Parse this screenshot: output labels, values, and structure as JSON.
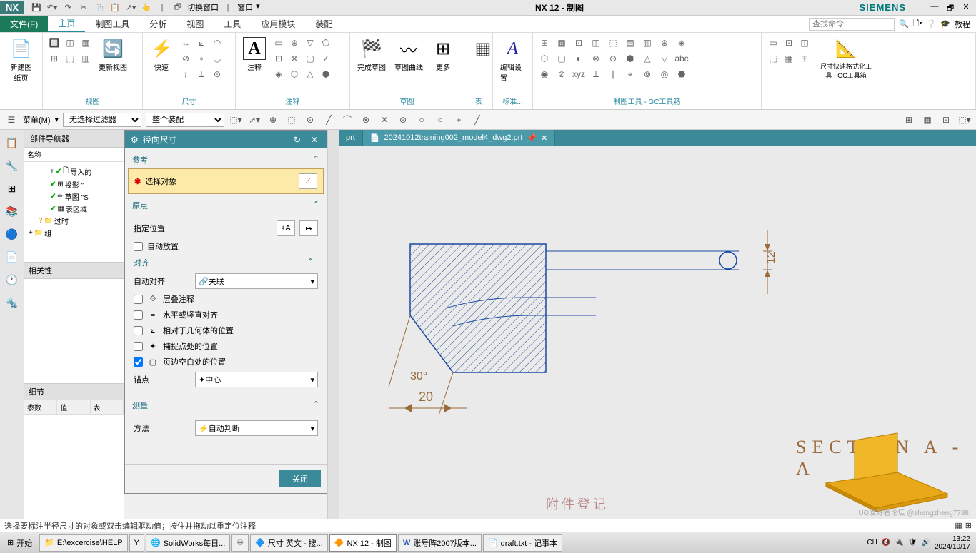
{
  "title": "NX 12 - 制图",
  "brand": "SIEMENS",
  "menubar": {
    "file": "文件(F)",
    "tabs": [
      "主页",
      "制图工具",
      "分析",
      "视图",
      "工具",
      "应用模块",
      "装配"
    ],
    "search_placeholder": "查找命令",
    "tutorial": "教程"
  },
  "qat": {
    "switch_window": "切换窗口",
    "window": "窗口"
  },
  "ribbon": {
    "new_sheet": "新建图纸页",
    "update_view": "更新视图",
    "rapid": "快速",
    "annotate": "注释",
    "finish_sketch": "完成草图",
    "sketch_curve": "草图曲线",
    "more": "更多",
    "edit_settings": "编辑设置",
    "dim_format": "尺寸快速格式化工具 - GC工具箱",
    "groups": {
      "view": "视图",
      "dimension": "尺寸",
      "annotation": "注释",
      "sketch": "草图",
      "table": "表",
      "standard": "标准...",
      "drafting_tools": "制图工具 - GC工具箱"
    }
  },
  "toolbar2": {
    "menu": "菜单(M)",
    "no_filter": "无选择过滤器",
    "whole_assembly": "整个装配"
  },
  "nav": {
    "title": "部件导航器",
    "col_name": "名称",
    "items": {
      "imported": "导入的",
      "projection": "投影 \"",
      "sketch": "草图 \"S",
      "table_area": "表区域",
      "outdated": "过时",
      "group": "组"
    },
    "relativity": "相关性",
    "detail": "细节",
    "cols": {
      "param": "参数",
      "value": "值",
      "expr": "表"
    }
  },
  "dialog": {
    "title": "径向尺寸",
    "sections": {
      "reference": "参考",
      "select_object": "选择对象",
      "origin": "原点",
      "specify_position": "指定位置",
      "auto_place": "自动放置",
      "alignment": "对齐",
      "auto_align_label": "自动对齐",
      "auto_align_value": "关联",
      "overlay_annotation": "层叠注释",
      "horiz_vert_align": "水平或竖直对齐",
      "relative_to_geometry": "相对于几何体的位置",
      "snap_point_pos": "捕捉点处的位置",
      "page_margin_pos": "页边空白处的位置",
      "anchor_label": "锚点",
      "anchor_value": "中心",
      "measure": "测量",
      "method_label": "方法",
      "method_value": "自动判断"
    },
    "close": "关闭"
  },
  "canvas": {
    "tab1": "prt",
    "tab2": "20241012training002_model4_dwg2.prt",
    "section_label": "SECTION  A - A",
    "dim_12": "12",
    "dim_20": "20",
    "dim_30": "30°",
    "registration": "附件登记"
  },
  "statusbar": {
    "msg": "选择要标注半径尺寸的对象或双击编辑驱动值；按住并拖动以重定位注释"
  },
  "taskbar": {
    "start": "开始",
    "items": [
      "E:\\excercise\\HELP",
      "",
      "SolidWorks每日...",
      "",
      "尺寸 英文 - 搜...",
      "NX 12 - 制图",
      "账号阵2007版本...",
      "draft.txt - 记事本"
    ],
    "ime": "CH",
    "time": "13:22",
    "date": "2024/10/17"
  },
  "watermark": "UG爱好者论坛 @zhengzheng7798"
}
